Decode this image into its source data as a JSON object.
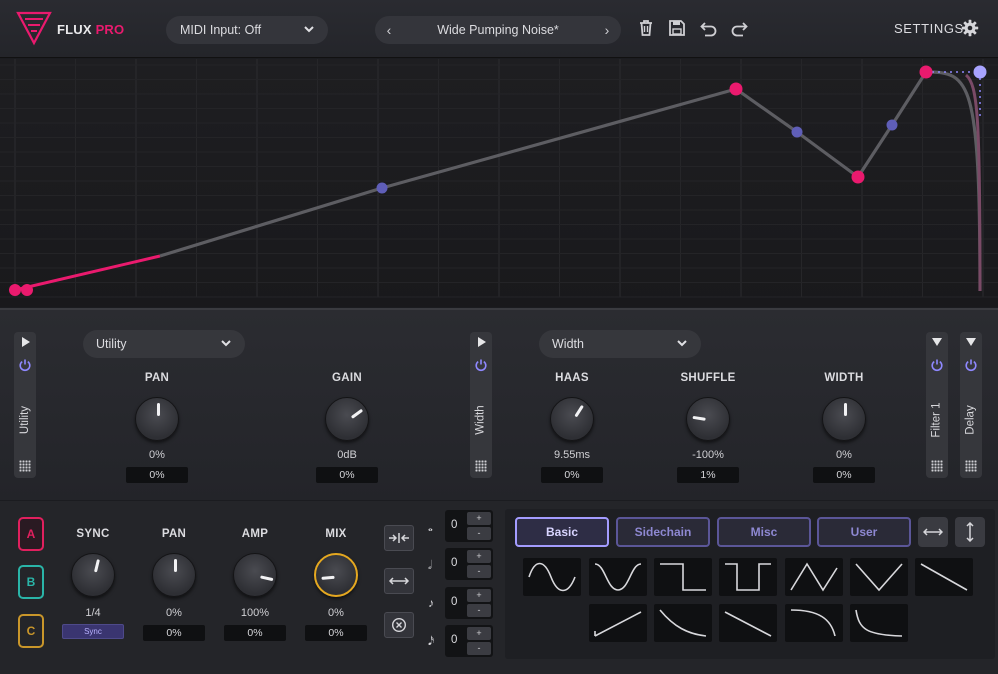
{
  "header": {
    "brand_name": "FLUX",
    "brand_suffix": "PRO",
    "midi_input": "MIDI Input: Off",
    "preset_name": "Wide Pumping Noise*",
    "settings_label": "SETTINGS",
    "icons": [
      "logo-icon",
      "chevron-down-icon",
      "chevron-left-icon",
      "chevron-right-icon",
      "trash-icon",
      "save-icon",
      "undo-icon",
      "redo-icon",
      "gear-icon"
    ]
  },
  "colors": {
    "accent_pink": "#ea1a6e",
    "accent_purple": "#8f88ff",
    "node_blue": "#6f6ec4",
    "curve_gray": "#5a5a5e",
    "slot_a": "#e0205e",
    "slot_b": "#2ab5a8",
    "slot_c": "#c9962a",
    "mix_ring": "#e5a820"
  },
  "fx": {
    "slots": [
      {
        "label": "Utility",
        "state": "expanded"
      },
      {
        "label": "Width",
        "state": "expanded"
      },
      {
        "label": "Filter 1",
        "state": "collapsed"
      },
      {
        "label": "Delay",
        "state": "collapsed"
      }
    ],
    "utility_dropdown": "Utility",
    "width_dropdown": "Width",
    "utility_knobs": [
      {
        "label": "PAN",
        "value": "0%",
        "mod": "0%",
        "level": 0.5
      },
      {
        "label": "GAIN",
        "value": "0dB",
        "mod": "0%",
        "level": 0.7
      }
    ],
    "width_knobs": [
      {
        "label": "HAAS",
        "value": "9.55ms",
        "mod": "0%",
        "level": 0.62
      },
      {
        "label": "SHUFFLE",
        "value": "-100%",
        "mod": "1%",
        "level": 0.2
      },
      {
        "label": "WIDTH",
        "value": "0%",
        "mod": "0%",
        "level": 0.5
      }
    ]
  },
  "lfo": {
    "slots": [
      "A",
      "B",
      "C"
    ],
    "active_slot": "A",
    "knobs": [
      {
        "label": "SYNC",
        "value": "1/4",
        "mod": "Sync",
        "level": 0.55
      },
      {
        "label": "PAN",
        "value": "0%",
        "mod": "0%",
        "level": 0.5
      },
      {
        "label": "AMP",
        "value": "100%",
        "mod": "0%",
        "level": 0.88
      },
      {
        "label": "MIX",
        "value": "0%",
        "mod": "0%",
        "level": 0.15
      }
    ],
    "buttons": [
      "compress-icon",
      "stretch-icon",
      "clear-icon"
    ],
    "note_steppers": [
      {
        "note": "whole-note-icon",
        "value": "0"
      },
      {
        "note": "half-note-icon",
        "value": "0"
      },
      {
        "note": "eighth-note-icon",
        "value": "0"
      },
      {
        "note": "sixteenth-note-icon",
        "value": "0"
      }
    ],
    "stepper_plus": "+",
    "stepper_minus": "-",
    "tabs": [
      "Basic",
      "Sidechain",
      "Misc",
      "User"
    ],
    "active_tab": "Basic",
    "shapes": [
      "sine",
      "cosine",
      "square",
      "inverted-square",
      "triangle",
      "v-shape",
      "ramp-down",
      "saw-up",
      "exp-decay",
      "linear-down",
      "exp-fall",
      "sharp-decay"
    ]
  }
}
